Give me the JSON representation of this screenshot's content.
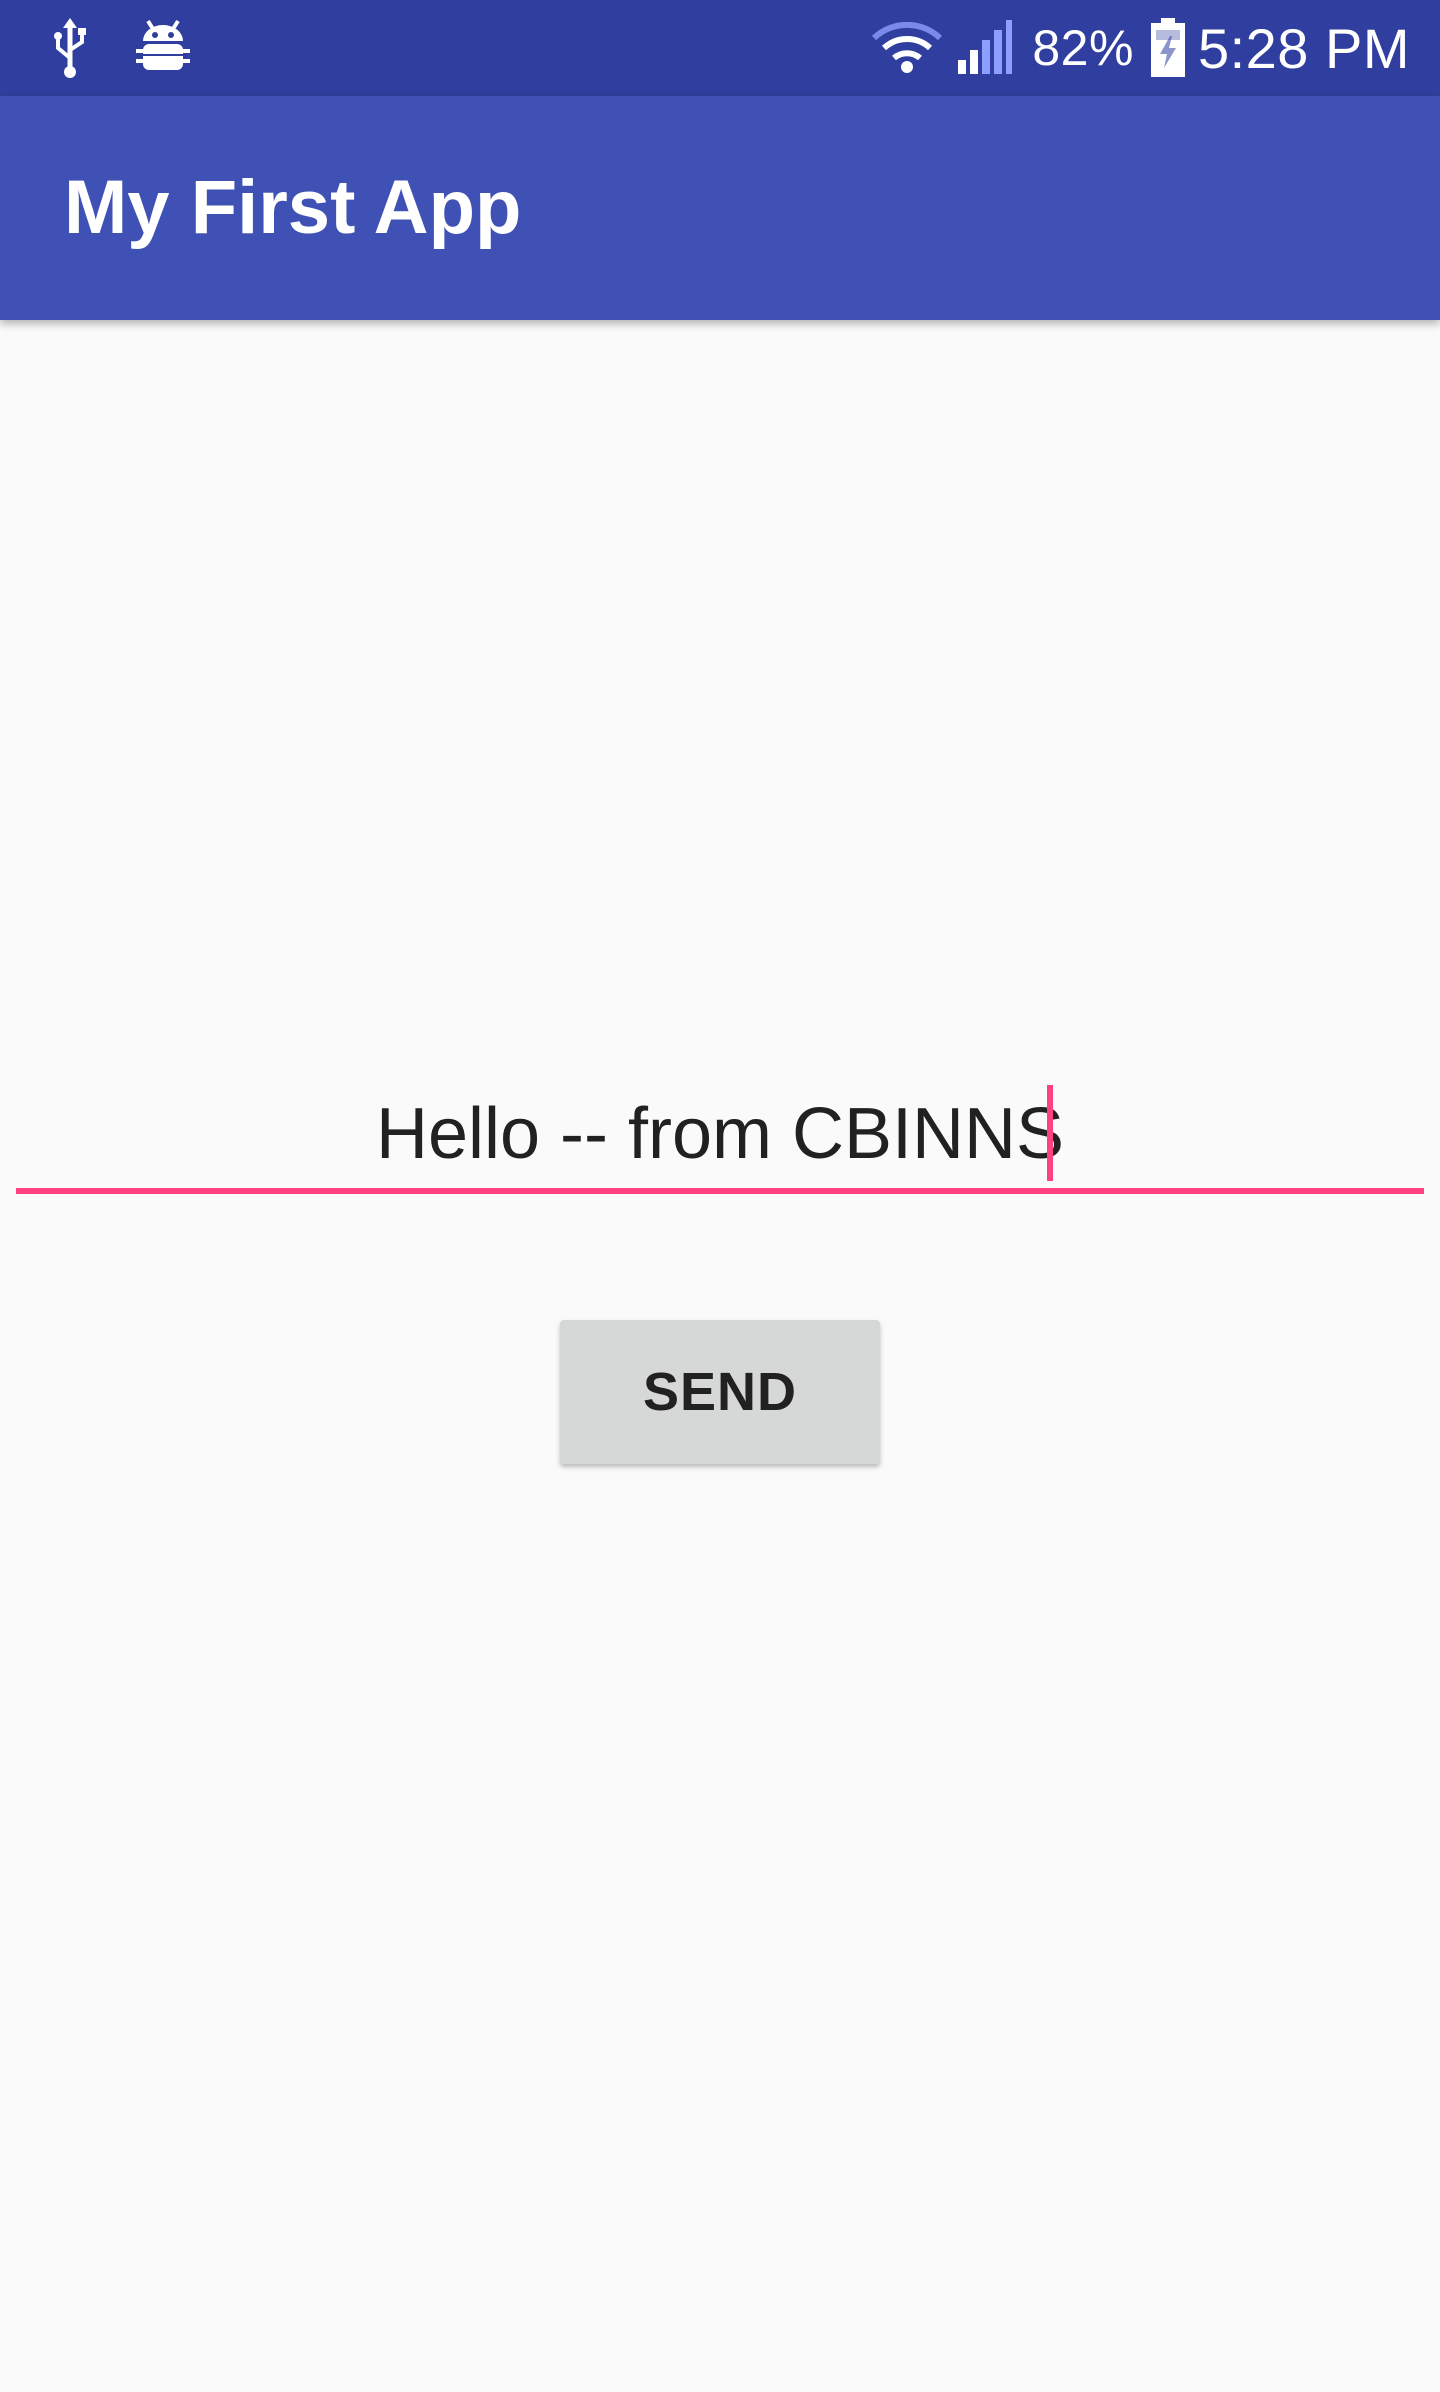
{
  "status_bar": {
    "left_icons": [
      "usb-icon",
      "android-debug-icon"
    ],
    "right_icons": [
      "wifi-icon",
      "signal-icon",
      "battery-charging-icon"
    ],
    "battery_percent": "82%",
    "time": "5:28 PM",
    "color": "#303f9f"
  },
  "app_bar": {
    "title": "My First App",
    "color": "#3f51b5"
  },
  "message_field": {
    "value": "Hello -- from CBINNS",
    "accent_color": "#ff4081"
  },
  "send_button": {
    "label": "SEND",
    "color": "#d6d7d7"
  }
}
